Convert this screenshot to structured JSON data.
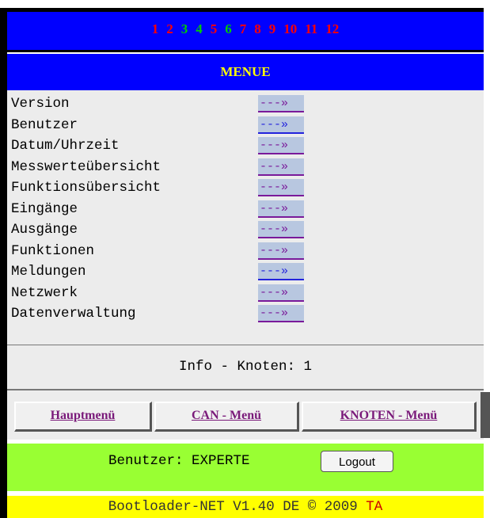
{
  "node_bar": {
    "nodes": [
      {
        "label": "1",
        "color": "#ff0000"
      },
      {
        "label": "2",
        "color": "#ff0000"
      },
      {
        "label": "3",
        "color": "#00cc00"
      },
      {
        "label": "4",
        "color": "#00cc00"
      },
      {
        "label": "5",
        "color": "#ff0000"
      },
      {
        "label": "6",
        "color": "#00cc00"
      },
      {
        "label": "7",
        "color": "#ff0000"
      },
      {
        "label": "8",
        "color": "#ff0000"
      },
      {
        "label": "9",
        "color": "#ff0000"
      },
      {
        "label": "10",
        "color": "#ff0000"
      },
      {
        "label": "11",
        "color": "#ff0000"
      },
      {
        "label": "12",
        "color": "#ff0000"
      }
    ]
  },
  "menu": {
    "title": "MENUE",
    "arrow": "---»",
    "items": [
      {
        "label": "Version"
      },
      {
        "label": "Benutzer"
      },
      {
        "label": "Datum/Uhrzeit"
      },
      {
        "label": "Messwerteübersicht"
      },
      {
        "label": "Funktionsübersicht"
      },
      {
        "label": "Eingänge"
      },
      {
        "label": "Ausgänge"
      },
      {
        "label": "Funktionen"
      },
      {
        "label": "Meldungen"
      },
      {
        "label": "Netzwerk"
      },
      {
        "label": "Datenverwaltung"
      }
    ]
  },
  "info": {
    "text": "Info - Knoten: 1"
  },
  "tabs": [
    {
      "label": "Hauptmenü"
    },
    {
      "label": "CAN - Menü"
    },
    {
      "label": "KNOTEN - Menü"
    }
  ],
  "user": {
    "label": "Benutzer: EXPERTE",
    "logout_label": "Logout"
  },
  "footer": {
    "text": "Bootloader-NET V1.40  DE © 2009",
    "brand": "TA"
  },
  "colors": {
    "bar_blue": "#0000ff",
    "title_yellow": "#ffff00",
    "user_green": "#99ff33",
    "footer_yellow": "#ffff00"
  }
}
